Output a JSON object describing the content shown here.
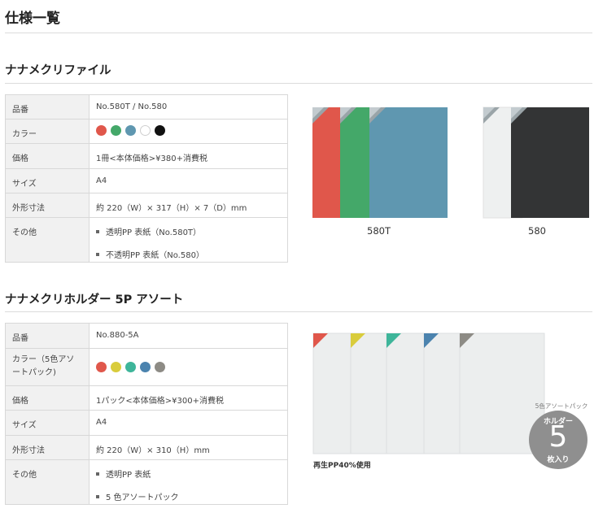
{
  "page_title": "仕様一覧",
  "section1": {
    "title": "ナナメクリファイル",
    "rows": {
      "code": {
        "label": "品番",
        "value": "No.580T / No.580"
      },
      "color": {
        "label": "カラー",
        "colors": [
          "#e0574b",
          "#44a869",
          "#5f97b0",
          "#ffffff",
          "#111111"
        ]
      },
      "price": {
        "label": "価格",
        "value": "1冊<本体価格>¥380+消費税"
      },
      "size": {
        "label": "サイズ",
        "value": "A4"
      },
      "dims": {
        "label": "外形寸法",
        "value": "約 220（W）× 317（H）× 7（D）mm"
      },
      "other": {
        "label": "その他",
        "items": [
          "透明PP 表紙（No.580T）",
          "不透明PP 表紙（No.580）"
        ]
      }
    },
    "captions": {
      "left": "580T",
      "right": "580"
    }
  },
  "section2": {
    "title": "ナナメクリホルダー 5P アソート",
    "rows": {
      "code": {
        "label": "品番",
        "value": "No.880-5A"
      },
      "color": {
        "label": "カラー（5色アソートパック)",
        "colors": [
          "#e0574b",
          "#d9cc3c",
          "#3eb59a",
          "#4b83ae",
          "#8d8b85"
        ]
      },
      "price": {
        "label": "価格",
        "value": "1パック<本体価格>¥300+消費税"
      },
      "size": {
        "label": "サイズ",
        "value": "A4"
      },
      "dims": {
        "label": "外形寸法",
        "value": "約 220（W）× 310（H）mm"
      },
      "other": {
        "label": "その他",
        "items": [
          "透明PP 表紙",
          "5 色アソートパック"
        ]
      }
    },
    "recycled_note": "再生PP40%使用",
    "badge": {
      "arc_text": "5色アソートパック",
      "line1": "ホルダー",
      "number": "5",
      "line2": "枚入り"
    }
  }
}
